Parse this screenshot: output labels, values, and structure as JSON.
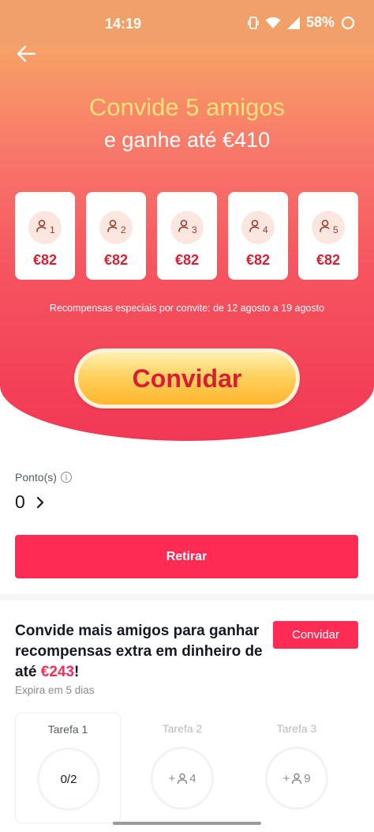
{
  "status_bar": {
    "time": "14:19",
    "battery": "58%"
  },
  "hero": {
    "back_icon": "arrow-left-icon",
    "title": "Convide 5 amigos",
    "subtitle": "e ganhe até €410",
    "slots": [
      {
        "number": "1",
        "amount": "€82",
        "icon": "person-icon"
      },
      {
        "number": "2",
        "amount": "€82",
        "icon": "person-icon"
      },
      {
        "number": "3",
        "amount": "€82",
        "icon": "person-icon"
      },
      {
        "number": "4",
        "amount": "€82",
        "icon": "person-icon"
      },
      {
        "number": "5",
        "amount": "€82",
        "icon": "person-icon"
      }
    ],
    "special_note": "Recompensas especiais por convite: de 12 agosto a 19 agosto",
    "invite_button": "Convidar"
  },
  "points": {
    "label": "Ponto(s)",
    "info_icon": "info-icon",
    "value": "0",
    "chevron_icon": "chevron-right-icon"
  },
  "withdraw_button": "Retirar",
  "extra": {
    "text_before": "Convide mais amigos para ganhar recompensas extra em dinheiro de até ",
    "amount": "€243",
    "text_after": "!",
    "invite_button": "Convidar",
    "expires": "Expira em 5 dias",
    "tasks": [
      {
        "title": "Tarefa 1",
        "prefix": "",
        "value": "0/2",
        "show_icon": false
      },
      {
        "title": "Tarefa 2",
        "prefix": "+",
        "value": "4",
        "show_icon": true
      },
      {
        "title": "Tarefa 3",
        "prefix": "+",
        "value": "9",
        "show_icon": true
      }
    ]
  },
  "colors": {
    "accent": "#fe2c55",
    "hero_top": "#f7a266",
    "hero_bottom": "#f23855",
    "title_yellow": "#ffe17a"
  }
}
